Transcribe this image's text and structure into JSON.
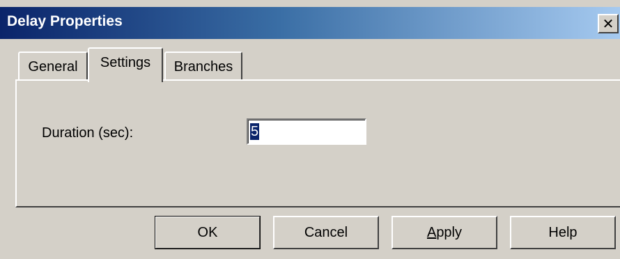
{
  "window": {
    "title": "Delay Properties",
    "close_glyph": "✕"
  },
  "tabs": [
    {
      "label": "General",
      "selected": false
    },
    {
      "label": "Settings",
      "selected": true
    },
    {
      "label": "Branches",
      "selected": false
    }
  ],
  "settings": {
    "duration_label": "Duration (sec):",
    "duration_value": "5"
  },
  "buttons": {
    "ok": "OK",
    "cancel": "Cancel",
    "apply_accel": "A",
    "apply_rest": "pply",
    "help": "Help"
  },
  "colors": {
    "titlebar_start": "#0a246a",
    "titlebar_end": "#a6caf0",
    "face": "#d4d0c8",
    "selection": "#0a246a"
  }
}
